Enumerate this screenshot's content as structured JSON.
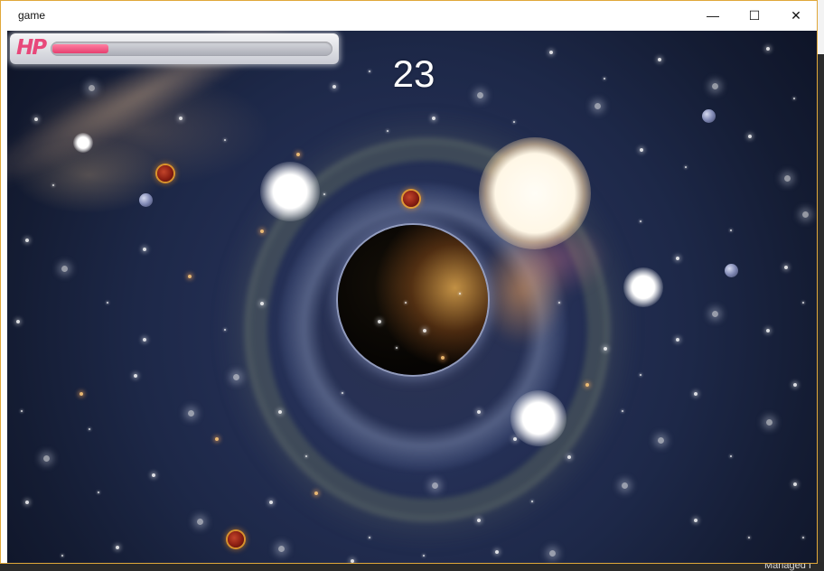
{
  "window": {
    "title": "game",
    "minimize_glyph": "—",
    "maximize_glyph": "☐",
    "close_glyph": "✕"
  },
  "hud": {
    "hp_label": "HP",
    "hp_fraction": 0.2,
    "score": "23"
  },
  "background_app": {
    "status_text": "Managed I"
  },
  "colors": {
    "hp_accent": "#e8487a",
    "window_border": "#e0a83a"
  },
  "sprites": {
    "meteor_icon": "fire-meteor-icon",
    "asteroid_icon": "rock-asteroid-icon",
    "black_hole": "black-hole"
  }
}
